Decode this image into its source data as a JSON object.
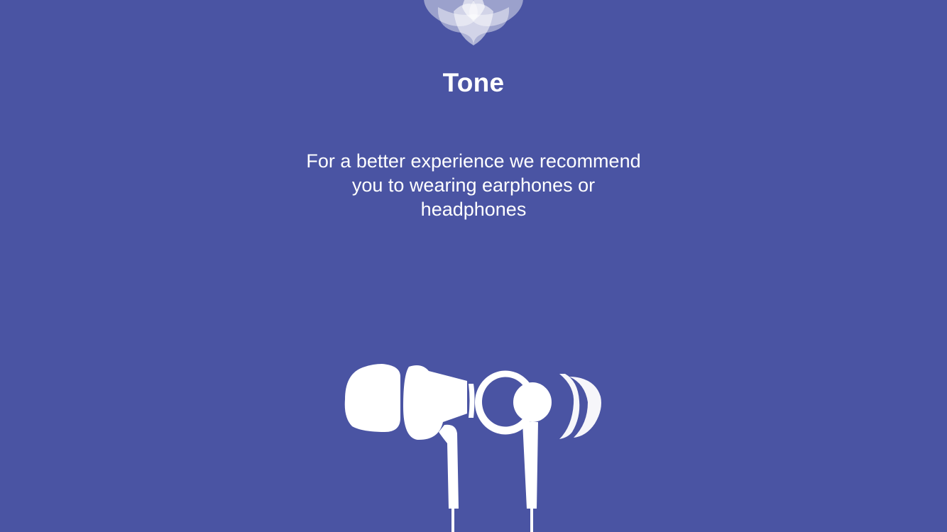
{
  "app": {
    "title": "Tone",
    "logo_icon": "lotus-icon"
  },
  "message": {
    "lines": [
      "For a better experience we recommend",
      "you to wearing earphones or",
      "headphones"
    ]
  },
  "illustration": {
    "icon": "earphones-icon"
  },
  "colors": {
    "background": "#4a54a3",
    "foreground": "#ffffff"
  }
}
